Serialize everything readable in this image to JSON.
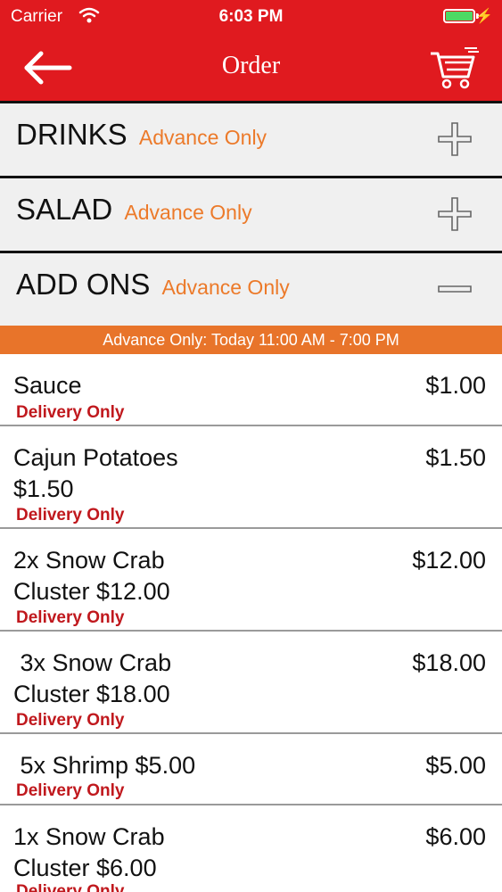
{
  "status_bar": {
    "carrier": "Carrier",
    "time": "6:03 PM"
  },
  "nav": {
    "title": "Order"
  },
  "categories": [
    {
      "name": "DRINKS",
      "tag": "Advance Only",
      "state": "collapsed"
    },
    {
      "name": "SALAD",
      "tag": "Advance Only",
      "state": "collapsed"
    },
    {
      "name": "ADD ONS",
      "tag": "Advance Only",
      "state": "expanded"
    }
  ],
  "availability": "Advance Only: Today 11:00 AM - 7:00 PM",
  "items": [
    {
      "name": "Sauce",
      "price": "$1.00",
      "note": "Delivery Only"
    },
    {
      "name": "Cajun Potatoes\n$1.50",
      "price": "$1.50",
      "note": "Delivery Only"
    },
    {
      "name": "2x Snow Crab\nCluster $12.00",
      "price": "$12.00",
      "note": "Delivery Only"
    },
    {
      "name": " 3x Snow Crab\nCluster $18.00",
      "price": "$18.00",
      "note": "Delivery Only"
    },
    {
      "name": " 5x Shrimp $5.00",
      "price": "$5.00",
      "note": "Delivery Only"
    },
    {
      "name": "1x Snow Crab\nCluster $6.00",
      "price": "$6.00",
      "note": "Delivery Only"
    }
  ],
  "colors": {
    "header": "#e01a1f",
    "accent_orange": "#ec7a2a",
    "delivery_red": "#c0181d",
    "battery": "#4cd964"
  },
  "icons": {
    "back": "back-arrow-icon",
    "cart": "cart-icon",
    "expand": "plus-icon",
    "collapse": "minus-icon",
    "wifi": "wifi-icon",
    "battery": "battery-icon",
    "charging": "bolt-icon"
  }
}
